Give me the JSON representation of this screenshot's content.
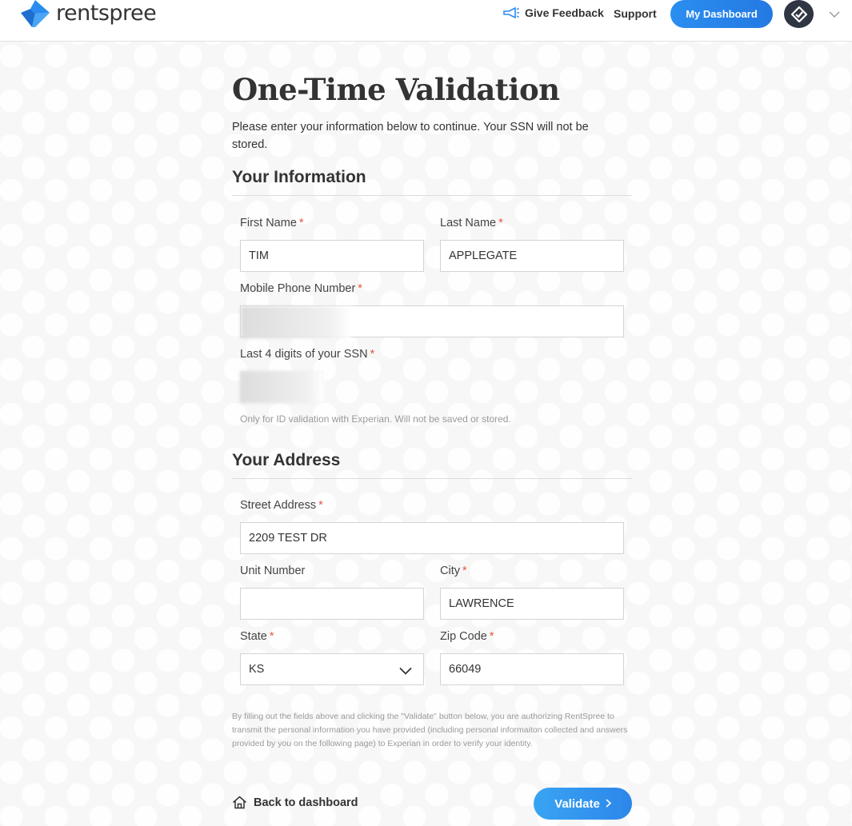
{
  "header": {
    "brand": "rentspree",
    "feedback_label": "Give Feedback",
    "support_label": "Support",
    "dashboard_label": "My Dashboard",
    "icons": {
      "logo": "rentspree-logo-icon",
      "feedback": "megaphone-icon",
      "avatar": "user-avatar-icon",
      "menu": "chevron-down-icon"
    }
  },
  "page": {
    "title": "One-Time Validation",
    "intro": "Please enter your information below to continue. Your SSN will not be stored."
  },
  "info_section": {
    "title": "Your Information",
    "first_name": {
      "label": "First Name",
      "value": "TIM"
    },
    "last_name": {
      "label": "Last Name",
      "value": "APPLEGATE"
    },
    "phone": {
      "label": "Mobile Phone Number"
    },
    "ssn": {
      "label": "Last 4 digits of your SSN",
      "hint": "Only for ID validation with Experian. Will not be saved or stored."
    }
  },
  "address_section": {
    "title": "Your Address",
    "street": {
      "label": "Street Address",
      "value": "2209 TEST DR"
    },
    "unit": {
      "label": "Unit Number",
      "value": ""
    },
    "city": {
      "label": "City",
      "value": "LAWRENCE"
    },
    "state": {
      "label": "State",
      "value": "KS"
    },
    "zip": {
      "label": "Zip Code",
      "value": "66049"
    }
  },
  "required_mark": "*",
  "disclaimer": "By filling out the fields above and clicking the \"Validate\" button below, you are authorizing RentSpree to transmit the personal information you have provided (including personal informaiton collected and answers provided by you on the following page) to Experian in order to verify your identity.",
  "footer": {
    "back_label": "Back to dashboard",
    "validate_label": "Validate"
  },
  "colors": {
    "accent": "#2680eb",
    "required": "#e8553e",
    "brand_blue": "#2a8cf0"
  }
}
